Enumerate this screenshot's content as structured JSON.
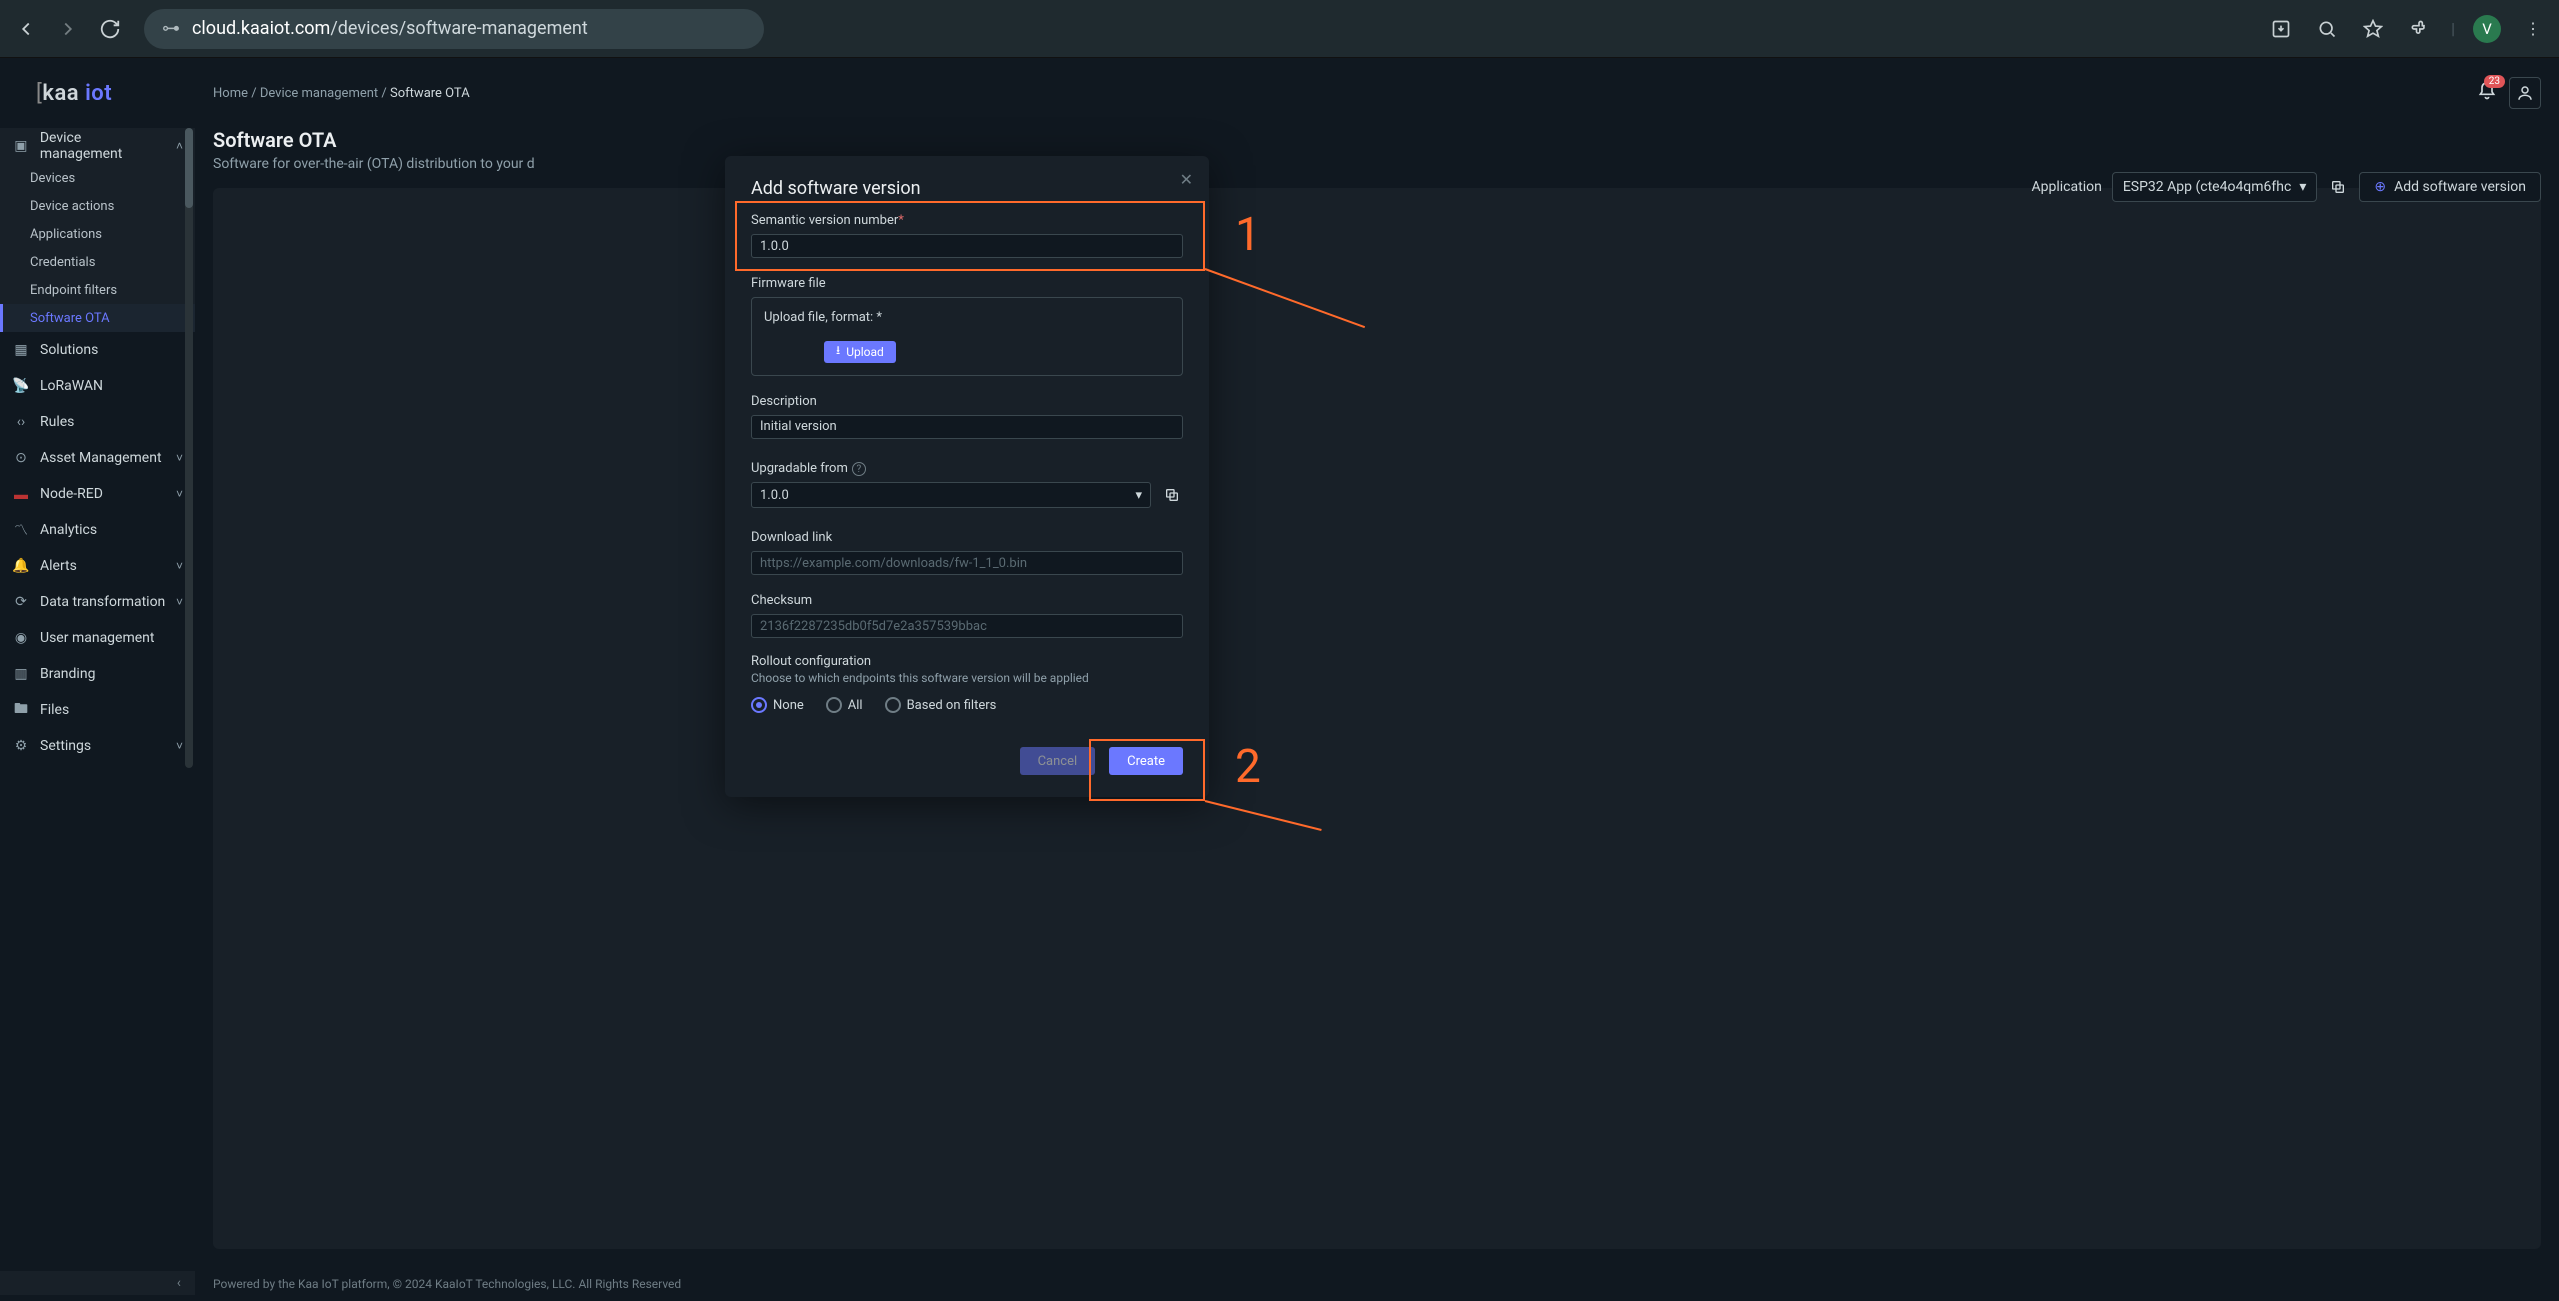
{
  "browser": {
    "url_host": "cloud.kaaiot.com",
    "url_path": "/devices/software-management",
    "avatar_letter": "V"
  },
  "logo": "kaa",
  "sidebar": {
    "items": [
      {
        "label": "Device management",
        "icon": "device-chip-icon",
        "expanded": true,
        "children": [
          {
            "label": "Devices"
          },
          {
            "label": "Device actions"
          },
          {
            "label": "Applications"
          },
          {
            "label": "Credentials"
          },
          {
            "label": "Endpoint filters"
          },
          {
            "label": "Software OTA",
            "active": true
          }
        ]
      },
      {
        "label": "Solutions",
        "icon": "grid-icon"
      },
      {
        "label": "LoRaWAN",
        "icon": "antenna-icon"
      },
      {
        "label": "Rules",
        "icon": "code-icon"
      },
      {
        "label": "Asset Management",
        "icon": "target-icon",
        "chevron": true
      },
      {
        "label": "Node-RED",
        "icon": "nodered-icon",
        "chevron": true
      },
      {
        "label": "Analytics",
        "icon": "trend-icon"
      },
      {
        "label": "Alerts",
        "icon": "bell-icon",
        "chevron": true
      },
      {
        "label": "Data transformation",
        "icon": "refresh-icon",
        "chevron": true
      },
      {
        "label": "User management",
        "icon": "user-circle-icon"
      },
      {
        "label": "Branding",
        "icon": "building-icon"
      },
      {
        "label": "Files",
        "icon": "folder-icon"
      },
      {
        "label": "Settings",
        "icon": "gear-icon",
        "chevron": true
      }
    ]
  },
  "breadcrumb": [
    {
      "label": "Home"
    },
    {
      "label": "Device management"
    },
    {
      "label": "Software OTA"
    }
  ],
  "notifications_count": "23",
  "page": {
    "title": "Software OTA",
    "subtitle": "Software for over-the-air (OTA) distribution to your d"
  },
  "actions": {
    "app_label": "Application",
    "app_selected": "ESP32 App (cte4o4qm6fhc",
    "add_label": "Add software version"
  },
  "footer": "Powered by the Kaa IoT platform, © 2024 KaaIoT Technologies, LLC. All Rights Reserved",
  "modal": {
    "title": "Add software version",
    "sem_label": "Semantic version number",
    "sem_value": "1.0.0",
    "firmware_label": "Firmware file",
    "upload_label": "Upload file, format: *",
    "upload_btn": "Upload",
    "desc_label": "Description",
    "desc_value": "Initial version",
    "upgradable_label": "Upgradable from",
    "upgradable_value": "1.0.0",
    "download_label": "Download link",
    "download_placeholder": "https://example.com/downloads/fw-1_1_0.bin",
    "checksum_label": "Checksum",
    "checksum_placeholder": "2136f2287235db0f5d7e2a357539bbac",
    "rollout_title": "Rollout configuration",
    "rollout_sub": "Choose to which endpoints this software version will be applied",
    "radio_none": "None",
    "radio_all": "All",
    "radio_filters": "Based on filters",
    "cancel": "Cancel",
    "create": "Create"
  },
  "annotations": {
    "one": "1",
    "two": "2"
  }
}
